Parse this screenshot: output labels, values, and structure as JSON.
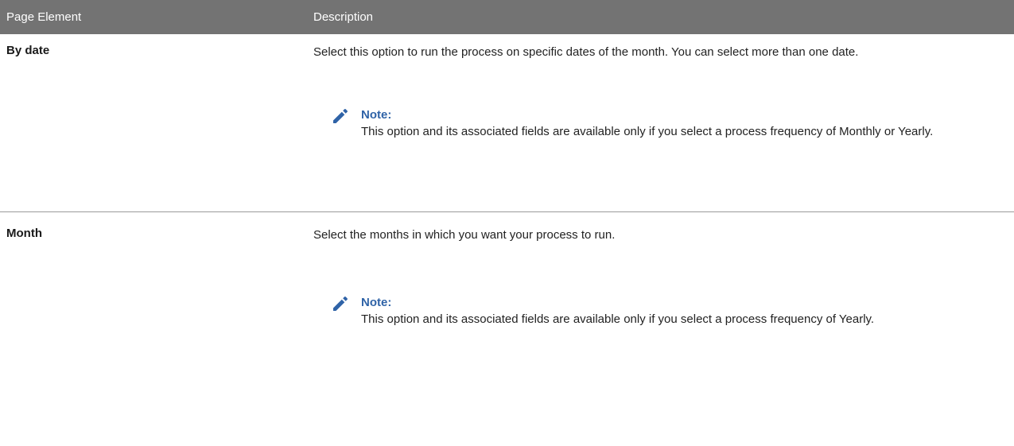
{
  "table": {
    "headers": {
      "element": "Page Element",
      "description": "Description"
    },
    "rows": [
      {
        "element": "By date",
        "description": "Select this option to run the process on specific dates of the month. You can select more than one date.",
        "note_title": "Note:",
        "note_text": "This option and its associated fields are available only if you select a process frequency of Monthly or Yearly.",
        "note_icon": "pencil-icon"
      },
      {
        "element": "Month",
        "description": "Select the months in which you want your process to run.",
        "note_title": "Note:",
        "note_text": "This option and its associated fields are available only if you select a process frequency of Yearly.",
        "note_icon": "pencil-icon"
      }
    ]
  },
  "colors": {
    "header_bg": "#737373",
    "note_accent": "#2f63a7"
  }
}
